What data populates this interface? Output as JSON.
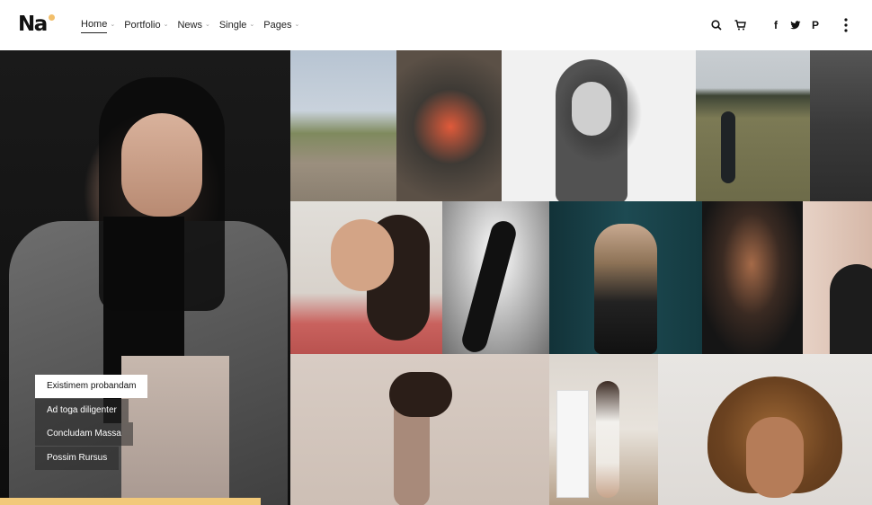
{
  "logo": {
    "text": "Na",
    "accent_color": "#f2bf6b"
  },
  "nav": {
    "items": [
      {
        "label": "Home",
        "active": true
      },
      {
        "label": "Portfolio"
      },
      {
        "label": "News"
      },
      {
        "label": "Single"
      },
      {
        "label": "Pages"
      }
    ],
    "caret": "⌄"
  },
  "header_icons": {
    "search": "search-icon",
    "cart": "cart-icon",
    "facebook": "f",
    "twitter": "twitter-icon",
    "pinterest": "P",
    "menu": "menu-dots-icon"
  },
  "categories": [
    {
      "label": "Existimem probandam",
      "active": true
    },
    {
      "label": "Ad toga diligenter"
    },
    {
      "label": "Concludam Massa"
    },
    {
      "label": "Possim Rursus"
    }
  ],
  "colors": {
    "accent": "#f2c97a",
    "text": "#111111"
  }
}
